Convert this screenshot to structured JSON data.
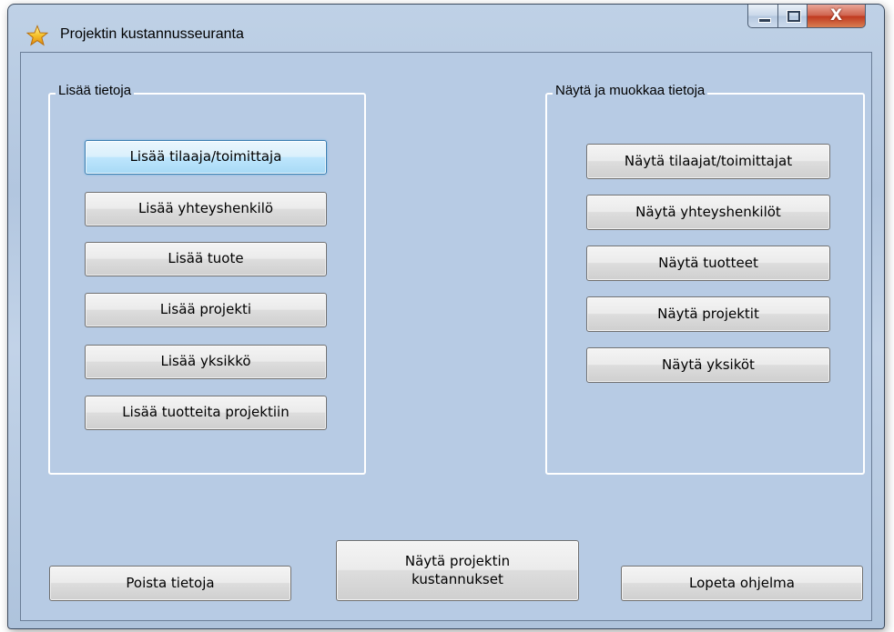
{
  "window": {
    "title": "Projektin kustannusseuranta",
    "icon": "star-icon",
    "controls": {
      "minimize": "minimize-icon",
      "maximize": "maximize-icon",
      "close": "X"
    }
  },
  "add_group": {
    "title": "Lisää tietoja",
    "buttons": [
      "Lisää tilaaja/toimittaja",
      "Lisää yhteyshenkilö",
      "Lisää tuote",
      "Lisää projekti",
      "Lisää yksikkö",
      "Lisää tuotteita projektiin"
    ]
  },
  "view_group": {
    "title": "Näytä ja muokkaa tietoja",
    "buttons": [
      "Näytä tilaajat/toimittajat",
      "Näytä yhteyshenkilöt",
      "Näytä tuotteet",
      "Näytä projektit",
      "Näytä yksiköt"
    ]
  },
  "bottom": {
    "delete_label": "Poista tietoja",
    "costs_label_line1": "Näytä projektin",
    "costs_label_line2": "kustannukset",
    "quit_label": "Lopeta ohjelma"
  },
  "colors": {
    "client_bg": "#b7cbe4",
    "focus_border": "#3c7fb1",
    "close_red": "#c0391f"
  }
}
